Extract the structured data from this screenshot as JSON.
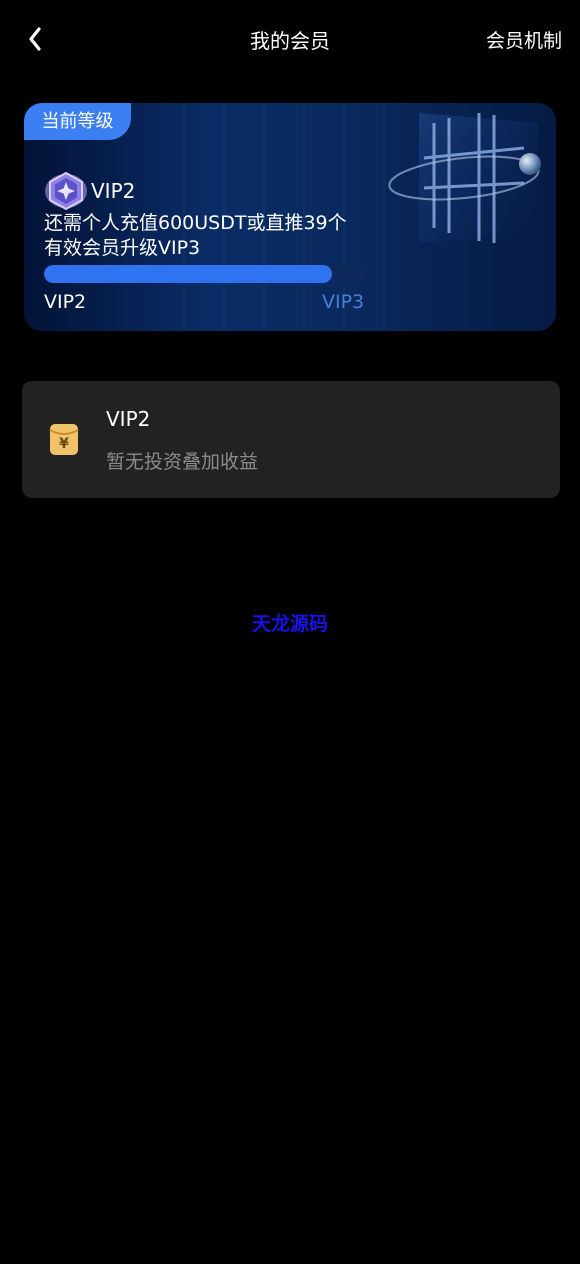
{
  "header": {
    "title": "我的会员",
    "mechanism_link": "会员机制",
    "back_icon": "chevron-left-icon"
  },
  "level_card": {
    "tag": "当前等级",
    "badge_icon": "vip-badge-icon",
    "current_level": "VIP2",
    "hint_line1": "还需个人充值600USDT或直推39个",
    "hint_line2": "有效会员升级VIP3",
    "progress_fraction": 0.9,
    "level_from": "VIP2",
    "level_to": "VIP3",
    "colors": {
      "tag": "#3b7ff2",
      "progress_fill": "#2f73f0",
      "progress_track": "#0e2a5c",
      "next_level_text": "#4a7fd8"
    }
  },
  "benefit_card": {
    "icon": "red-envelope-yen-icon",
    "title": "VIP2",
    "description": "暂无投资叠加收益"
  },
  "watermark": {
    "text": "天龙源码",
    "color": "#1812e6"
  }
}
